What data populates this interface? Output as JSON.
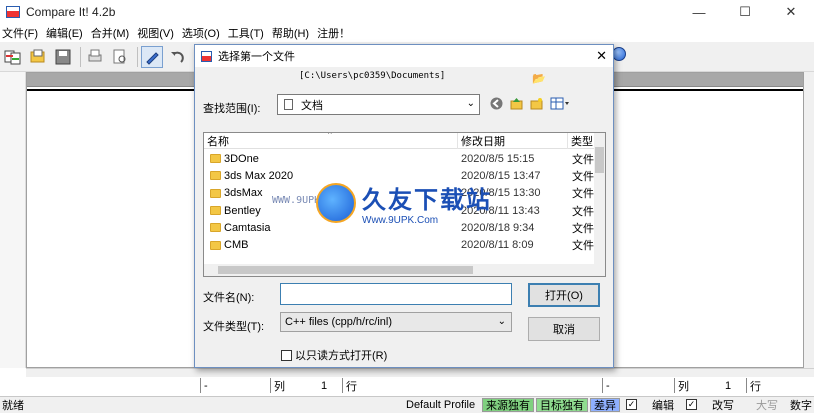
{
  "window": {
    "title": "Compare It! 4.2b",
    "minimize": "—",
    "maximize": "☐",
    "close": "✕"
  },
  "menu": [
    "文件(F)",
    "编辑(E)",
    "合并(M)",
    "视图(V)",
    "选项(O)",
    "工具(T)",
    "帮助(H)",
    "注册！"
  ],
  "status": {
    "ready": "就绪",
    "profile": "Default Profile",
    "source_only": "来源独有",
    "target_only": "目标独有",
    "diff": "差异",
    "edit": "编辑",
    "overwrite": "改写",
    "caps": "大写",
    "numlock": "数字",
    "colors": {
      "source_only": "#7fd07f",
      "target_only": "#8fdc8f",
      "diff": "#8fb0ff"
    }
  },
  "posbar_left": {
    "dash": "-",
    "col_label": "列",
    "col_value": "1",
    "row_label": "行"
  },
  "posbar_right": {
    "dash": "-",
    "col_label": "列",
    "col_value": "1",
    "row_label": "行"
  },
  "dialog": {
    "title": "选择第一个文件",
    "path": "[C:\\Users\\pc0359\\Documents]",
    "lookin_label": "查找范围(I):",
    "lookin_value": "文档",
    "columns": {
      "name": "名称",
      "date": "修改日期",
      "type": "类型"
    },
    "files": [
      {
        "name": "3DOne",
        "date": "2020/8/5 15:15",
        "type": "文件"
      },
      {
        "name": "3ds Max 2020",
        "date": "2020/8/15 13:47",
        "type": "文件"
      },
      {
        "name": "3dsMax",
        "date": "2020/8/15 13:30",
        "type": "文件"
      },
      {
        "name": "Bentley",
        "date": "2020/8/11 13:43",
        "type": "文件"
      },
      {
        "name": "Camtasia",
        "date": "2020/8/18 9:34",
        "type": "文件"
      },
      {
        "name": "CMB",
        "date": "2020/8/11 8:09",
        "type": "文件"
      }
    ],
    "filename_label": "文件名(N):",
    "filename_value": "",
    "filetype_label": "文件类型(T):",
    "filetype_value": "C++ files (cpp/h/rc/inl)",
    "open_button": "打开(O)",
    "cancel_button": "取消",
    "readonly_label": "以只读方式打开(R)",
    "close": "✕"
  },
  "watermark": {
    "title": "久友下载站",
    "url": "Www.9UPK.Com",
    "left_text": "WWW.9UPK.COM"
  }
}
